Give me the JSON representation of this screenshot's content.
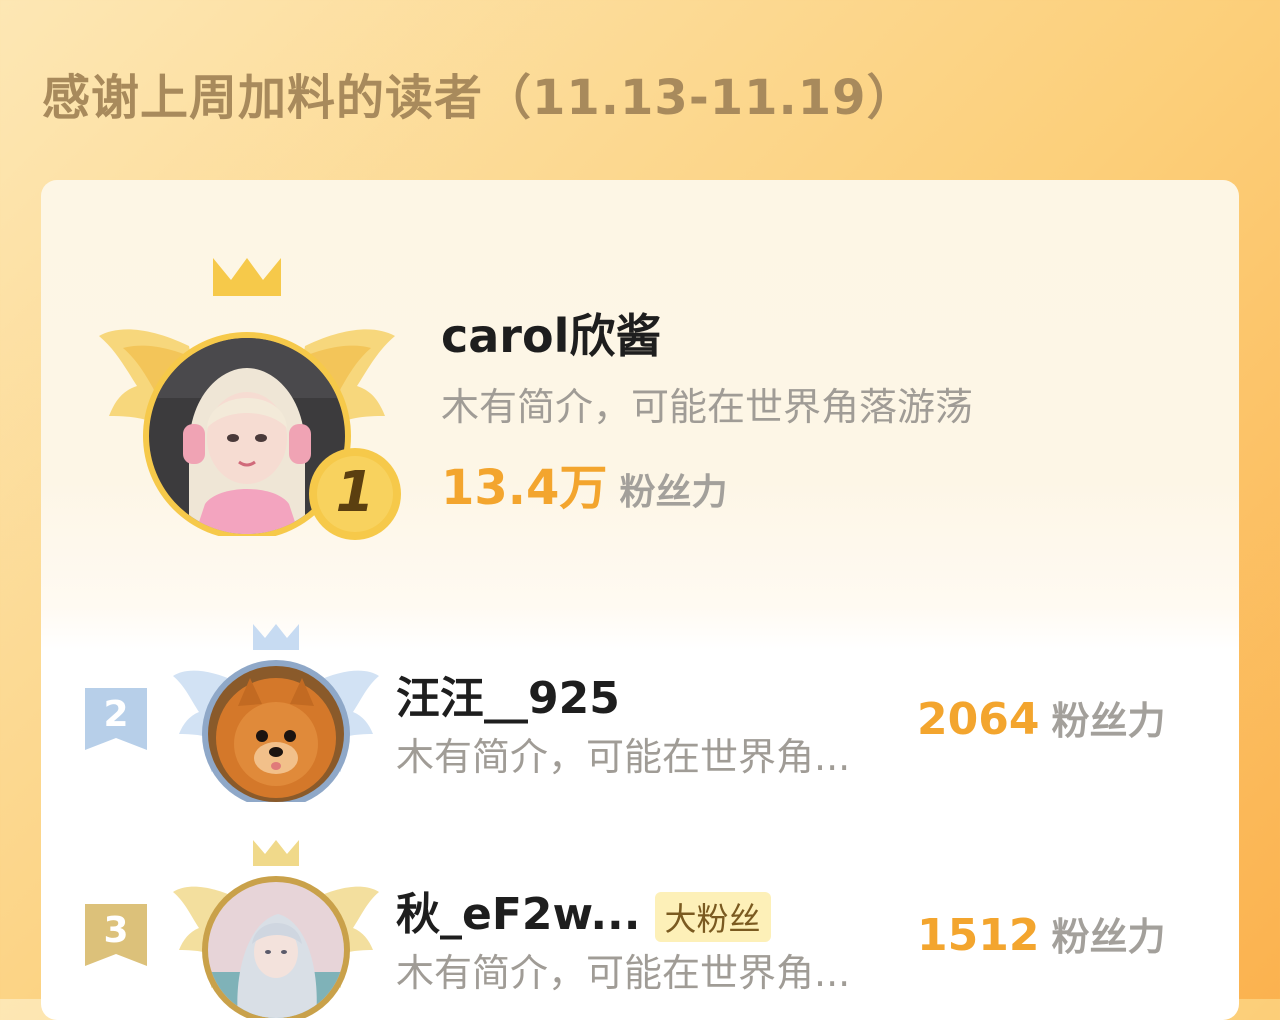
{
  "header": {
    "title": "感谢上周加料的读者（11.13-11.19）"
  },
  "colors": {
    "accent_orange": "#f3a52e",
    "gold": "#f6c94a",
    "silver_blue": "#a7c4e6",
    "bronze": "#d9b96a"
  },
  "ranking": [
    {
      "rank": "1",
      "name": "carol欣酱",
      "bio": "木有简介，可能在世界角落游荡",
      "score": "13.4万",
      "score_unit": "粉丝力",
      "badge_icon": "gold-wing-crown-icon"
    },
    {
      "rank": "2",
      "name": "汪汪__925",
      "bio": "木有简介，可能在世界角...",
      "score": "2064",
      "score_unit": "粉丝力",
      "badge_icon": "silver-wing-crown-icon"
    },
    {
      "rank": "3",
      "name": "秋_eF2w...",
      "tag": "大粉丝",
      "bio": "木有简介，可能在世界角...",
      "score": "1512",
      "score_unit": "粉丝力",
      "badge_icon": "bronze-wing-crown-icon"
    }
  ]
}
